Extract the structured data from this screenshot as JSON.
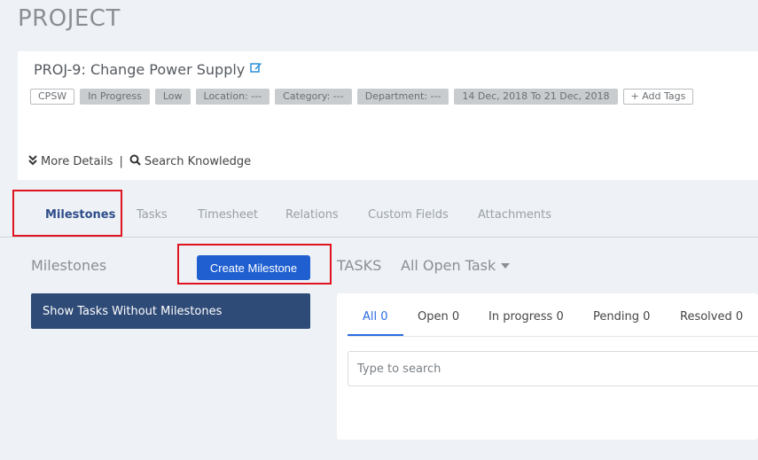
{
  "page": {
    "title": "PROJECT"
  },
  "project": {
    "name": "PROJ-9: Change Power Supply",
    "tags": [
      "CPSW",
      "In Progress",
      "Low",
      "Location: ---",
      "Category: ---",
      "Department: ---",
      "14 Dec, 2018 To 21 Dec, 2018"
    ],
    "add_tags_label": "+ Add Tags",
    "more_details_label": "More Details",
    "separator": "|",
    "search_knowledge_label": "Search Knowledge"
  },
  "tabs": [
    {
      "label": "Milestones",
      "active": true
    },
    {
      "label": "Tasks"
    },
    {
      "label": "Timesheet"
    },
    {
      "label": "Relations"
    },
    {
      "label": "Custom Fields"
    },
    {
      "label": "Attachments"
    }
  ],
  "milestones": {
    "heading": "Milestones",
    "create_button": "Create Milestone",
    "show_tasks_button": "Show Tasks Without Milestones"
  },
  "tasks": {
    "heading": "TASKS",
    "filter": "All Open Task",
    "status_tabs": [
      "All 0",
      "Open 0",
      "In progress 0",
      "Pending 0",
      "Resolved 0"
    ],
    "search_placeholder": "Type to search"
  },
  "colors": {
    "accent": "#1f5fd0",
    "dark_button": "#2e4a76",
    "highlight": "#e0141e",
    "active_tab": "#2f4d8a"
  }
}
